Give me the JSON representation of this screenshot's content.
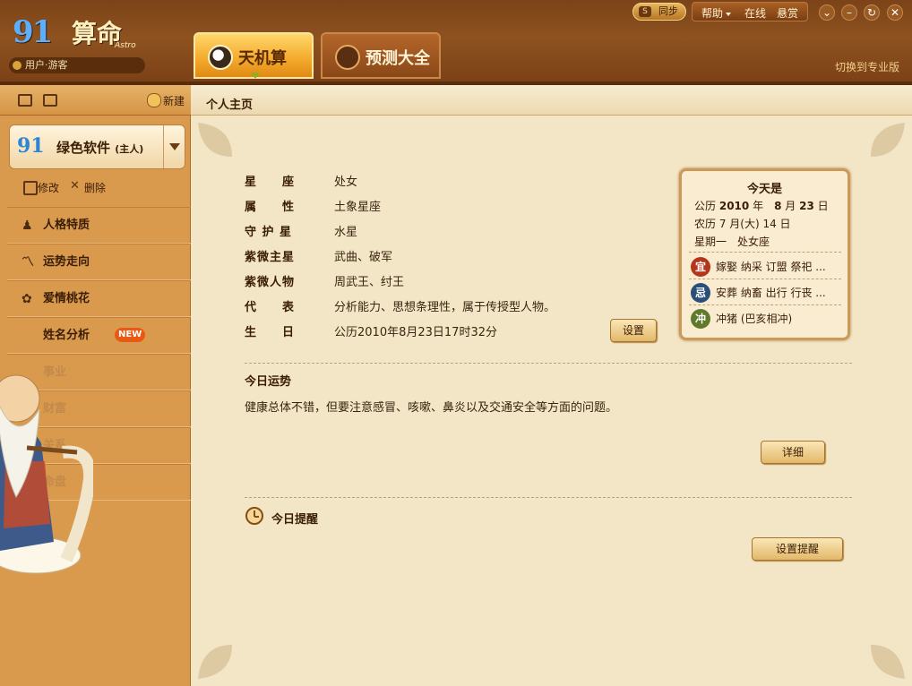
{
  "header": {
    "logo_text": "91",
    "logo_cn": "算命",
    "logo_sub": "Astro",
    "user_label": "用户·游客",
    "tabs": [
      {
        "label": "天机算",
        "active": true
      },
      {
        "label": "预测大全",
        "active": false
      }
    ],
    "sync_label": "同步",
    "menu": {
      "help": "帮助",
      "online": "在线",
      "reward": "悬赏"
    },
    "switch_label": "切换到专业版"
  },
  "sidebar": {
    "new_label": "新建",
    "profile": {
      "logo": "91",
      "name": "绿色软件",
      "tag": "(主人)"
    },
    "edit_label": "修改",
    "delete_label": "删除",
    "items": [
      {
        "label": "人格特质",
        "icon": "person-icon"
      },
      {
        "label": "运势走向",
        "icon": "trend-icon"
      },
      {
        "label": "爱情桃花",
        "icon": "flower-icon"
      },
      {
        "label": "姓名分析",
        "icon": "name-icon",
        "badge": "NEW"
      },
      {
        "label": "事业",
        "icon": "career-icon"
      },
      {
        "label": "财富",
        "icon": "wealth-icon"
      },
      {
        "label": "关系",
        "icon": "relation-icon"
      },
      {
        "label": "命盘",
        "icon": "chart-icon"
      }
    ]
  },
  "content": {
    "breadcrumb": "个人主页",
    "info": [
      {
        "label": "星　　座",
        "value": "处女"
      },
      {
        "label": "属　　性",
        "value": "土象星座"
      },
      {
        "label": "守 护 星",
        "value": "水星"
      },
      {
        "label": "紫微主星",
        "value": "武曲、破军"
      },
      {
        "label": "紫微人物",
        "value": "周武王、纣王"
      },
      {
        "label": "代　　表",
        "value": "分析能力、思想条理性，属于传授型人物。"
      },
      {
        "label": "生　　日",
        "value": "公历2010年8月23日17时32分"
      }
    ],
    "settings_button": "设置",
    "today": {
      "title": "今天是",
      "solar_prefix": "公历",
      "solar_year": "2010",
      "solar_year_unit": "年",
      "solar_month": "8",
      "solar_month_unit": "月",
      "solar_day": "23",
      "solar_day_unit": "日",
      "lunar": "农历 7 月(大) 14 日",
      "weekday": "星期一　处女座",
      "acts": [
        {
          "icon_text": "宜",
          "text": "嫁娶 纳采 订盟 祭祀 ...",
          "color": "#b5341a"
        },
        {
          "icon_text": "忌",
          "text": "安葬 纳畜 出行 行丧 ...",
          "color": "#2a4f7a"
        },
        {
          "icon_text": "冲",
          "text": "冲猪 (巴亥相冲)",
          "color": "#5f7a2a"
        }
      ]
    },
    "fortune": {
      "title": "今日运势",
      "text": "健康总体不错，但要注意感冒、咳嗽、鼻炎以及交通安全等方面的问题。",
      "detail_button": "详细"
    },
    "reminder": {
      "title": "今日提醒",
      "button": "设置提醒"
    }
  },
  "colors": {
    "frame_brown": "#7b4318",
    "tab_gold": "#f3a92b",
    "sidebar_tan": "#d99a4e",
    "content_paper": "#f3e6c6"
  }
}
